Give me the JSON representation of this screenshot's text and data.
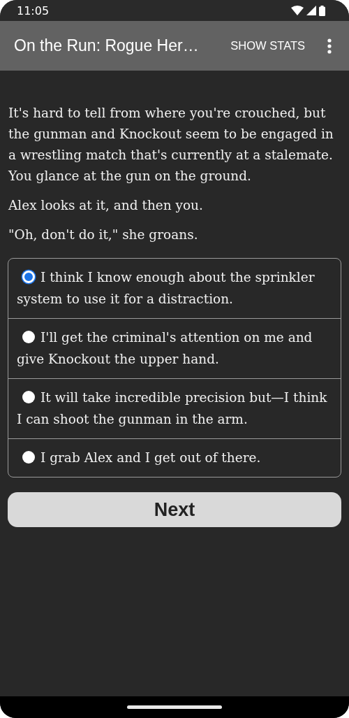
{
  "status_bar": {
    "time": "11:05"
  },
  "app_bar": {
    "title": "On the Run: Rogue Her…",
    "action": "SHOW STATS"
  },
  "paragraphs": [
    "It's hard to tell from where you're crouched, but the gunman and Knockout seem to be engaged in a wrestling match that's currently at a stalemate. You glance at the gun on the ground.",
    "Alex looks at it, and then you.",
    "\"Oh, don't do it,\" she groans."
  ],
  "choices": [
    {
      "label": "I think I know enough about the sprinkler system to use it for a distraction.",
      "selected": true
    },
    {
      "label": "I'll get the criminal's attention on me and give Knockout the upper hand.",
      "selected": false
    },
    {
      "label": "It will take incredible precision but—I think I can shoot the gunman in the arm.",
      "selected": false
    },
    {
      "label": "I grab Alex and I get out of there.",
      "selected": false
    }
  ],
  "next_button": "Next"
}
